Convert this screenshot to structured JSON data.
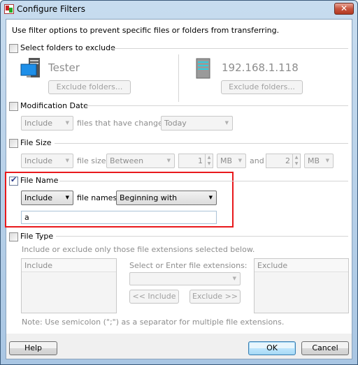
{
  "window": {
    "title": "Configure Filters",
    "close_label": "✕"
  },
  "intro": "Use filter options to prevent specific files or folders from transferring.",
  "folders": {
    "label": "Select folders to exclude",
    "checked": false,
    "local_name": "Tester",
    "remote_name": "192.168.1.118",
    "exclude_button": "Exclude folders..."
  },
  "mod_date": {
    "label": "Modification Date",
    "checked": false,
    "include": "Include",
    "text": "files that have changed",
    "period": "Today"
  },
  "file_size": {
    "label": "File Size",
    "checked": false,
    "include": "Include",
    "text": "file size",
    "mode": "Between",
    "min": "1",
    "min_unit": "MB",
    "and": "and",
    "max": "2",
    "max_unit": "MB"
  },
  "file_name": {
    "label": "File Name",
    "checked": true,
    "include": "Include",
    "text": "file names",
    "mode": "Beginning with",
    "value": "a",
    "highlight_color": "#e8191c"
  },
  "file_type": {
    "label": "File Type",
    "checked": false,
    "description": "Include or exclude only those file extensions selected below.",
    "include_header": "Include",
    "exclude_header": "Exclude",
    "select_label": "Select or Enter file extensions:",
    "select_value": "",
    "include_button": "<< Include",
    "exclude_button": "Exclude >>",
    "note": "Note: Use semicolon (\";\") as a separator for multiple file extensions."
  },
  "footer": {
    "help": "Help",
    "ok": "OK",
    "cancel": "Cancel"
  }
}
